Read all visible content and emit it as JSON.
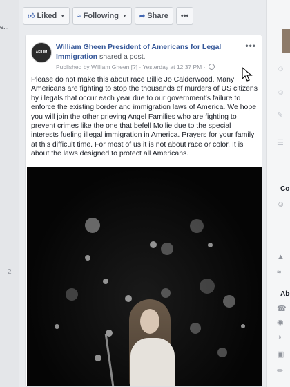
{
  "page": {
    "left_fragment": "e...",
    "left_number": "2"
  },
  "action_bar": {
    "liked": "Liked",
    "following": "Following",
    "share": "Share",
    "more": "•••"
  },
  "post": {
    "avatar_text": "AFILIM",
    "author": "William Gheen President of Americans for Legal Immigration",
    "action": "shared a post.",
    "more": "•••",
    "published_by": "Published by William Gheen",
    "help": "[?]",
    "timestamp": "Yesterday at 12:37 PM",
    "separator": "·",
    "body": "Please do not make this about race Billie Jo Calderwood. Many Americans are fighting to stop the thousands of murders of US citizens by illegals that occur each year due to our government's failure to enforce the existing border and immigration laws of America. We hope you will join the other grieving Angel Families who are fighting to prevent crimes like the one that befell Mollie due to the special interests fueling illegal immigration in America. Prayers for your family at this difficult time. For most of us it is not about race or color. It is about the laws designed to protect all Americans."
  },
  "right_sidebar": {
    "section_1": "Co",
    "section_2": "Abo"
  },
  "colors": {
    "link": "#365899",
    "accent": "#4267b2",
    "text": "#1d2129",
    "meta": "#90949c"
  }
}
